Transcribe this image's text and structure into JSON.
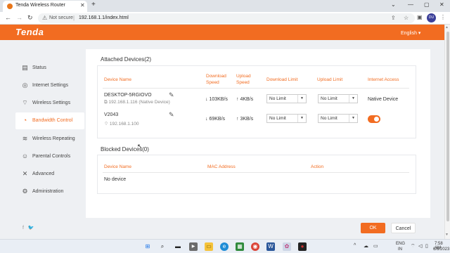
{
  "browser": {
    "tab_title": "Tenda Wireless Router",
    "not_secure": "Not secure",
    "url": "192.168.1.1/index.html",
    "profile_initials": "DU",
    "new_tab_glyph": "+",
    "close_glyph": "✕"
  },
  "header": {
    "logo": "Tenda",
    "language": "English ▾"
  },
  "sidebar": {
    "items": [
      {
        "label": "Status",
        "icon": "status-icon"
      },
      {
        "label": "Internet Settings",
        "icon": "globe-icon"
      },
      {
        "label": "Wireless Settings",
        "icon": "wifi-icon"
      },
      {
        "label": "Bandwidth Control",
        "icon": "bandwidth-icon"
      },
      {
        "label": "Wireless Repeating",
        "icon": "repeat-icon"
      },
      {
        "label": "Parental Controls",
        "icon": "parental-icon"
      },
      {
        "label": "Advanced",
        "icon": "tools-icon"
      },
      {
        "label": "Administration",
        "icon": "gear-icon"
      }
    ],
    "active_index": 3,
    "social": "f  🐦"
  },
  "attached": {
    "title": "Attached Devices(2)",
    "columns": {
      "device_name": "Device Name",
      "download_speed": "Download Speed",
      "upload_speed": "Upload Speed",
      "download_limit": "Download Limit",
      "upload_limit": "Upload Limit",
      "internet_access": "Internet Access"
    },
    "devices": [
      {
        "name": "DESKTOP-5RGIOVO",
        "ip": "192.168.1.116 (Native Device)",
        "download": "103KB/s",
        "upload": "4KB/s",
        "download_limit": "No Limit",
        "upload_limit": "No Limit",
        "access": "Native Device",
        "toggle": false
      },
      {
        "name": "V2043",
        "ip": "192.168.1.100",
        "download": "69KB/s",
        "upload": "3KB/s",
        "download_limit": "No Limit",
        "upload_limit": "No Limit",
        "access": "",
        "toggle": true
      }
    ]
  },
  "blocked": {
    "title": "Blocked Devices(0)",
    "columns": {
      "device_name": "Device Name",
      "mac": "MAC Address",
      "action": "Action"
    },
    "empty": "No device"
  },
  "buttons": {
    "ok": "OK",
    "cancel": "Cancel"
  },
  "taskbar": {
    "lang1": "ENG",
    "lang2": "IN",
    "time": "7:58 AM",
    "date": "6/8/2023"
  },
  "colors": {
    "accent": "#f26c21",
    "page_bg": "#eef0f3"
  }
}
